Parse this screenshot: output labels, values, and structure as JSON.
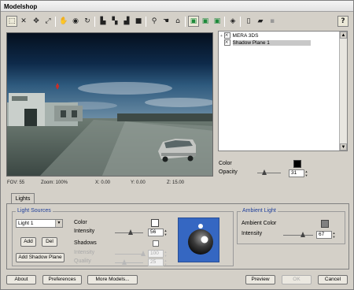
{
  "window": {
    "title": "Modelshop"
  },
  "toolbar": {
    "icons": [
      "select-icon",
      "delete-icon",
      "move-icon",
      "scale-icon",
      "hand-icon",
      "eye-icon",
      "rotate-icon",
      "align-icon",
      "align-icon",
      "align-icon",
      "box-icon",
      "zoom-icon",
      "pan-icon",
      "home-icon",
      "cube-icon",
      "cube-icon",
      "cube-icon",
      "view-icon",
      "new-icon",
      "open-icon",
      "save-icon",
      "help-icon"
    ],
    "help_label": "?"
  },
  "viewport": {
    "fov": "FOV: 55",
    "zoom": "Zoom: 100%",
    "x": "X: 0.00",
    "y": "Y: 0.00",
    "z": "Z: 15.00"
  },
  "tree": {
    "items": [
      {
        "label": "MERA 3DS",
        "selected": false
      },
      {
        "label": "Shadow Plane 1",
        "selected": true
      }
    ]
  },
  "properties": {
    "color_label": "Color",
    "color_value": "#000000",
    "opacity_label": "Opacity",
    "opacity_value": "31",
    "opacity_fraction": 0.31
  },
  "tabs": [
    {
      "label": "Lights"
    }
  ],
  "light_sources": {
    "title": "Light Sources",
    "selected_light": "Light 1",
    "add_label": "Add",
    "del_label": "Del",
    "add_shadow_plane_label": "Add Shadow Plane",
    "color_label": "Color",
    "color_value": "#ffffff",
    "intensity_label": "Intensity",
    "intensity_value": "56",
    "intensity_fraction": 0.56,
    "shadows_label": "Shadows",
    "shadows_checked": false,
    "shadow_intensity_label": "Intensity",
    "shadow_intensity_value": "100",
    "shadow_quality_label": "Quality",
    "shadow_quality_value": "25"
  },
  "ambient_light": {
    "title": "Ambient Light",
    "color_label": "Ambient Color",
    "color_value": "#808080",
    "intensity_label": "Intensity",
    "intensity_value": "67",
    "intensity_fraction": 0.67
  },
  "footer": {
    "about": "About",
    "preferences": "Preferences",
    "more_models": "More Models...",
    "preview": "Preview",
    "ok": "OK",
    "cancel": "Cancel"
  }
}
